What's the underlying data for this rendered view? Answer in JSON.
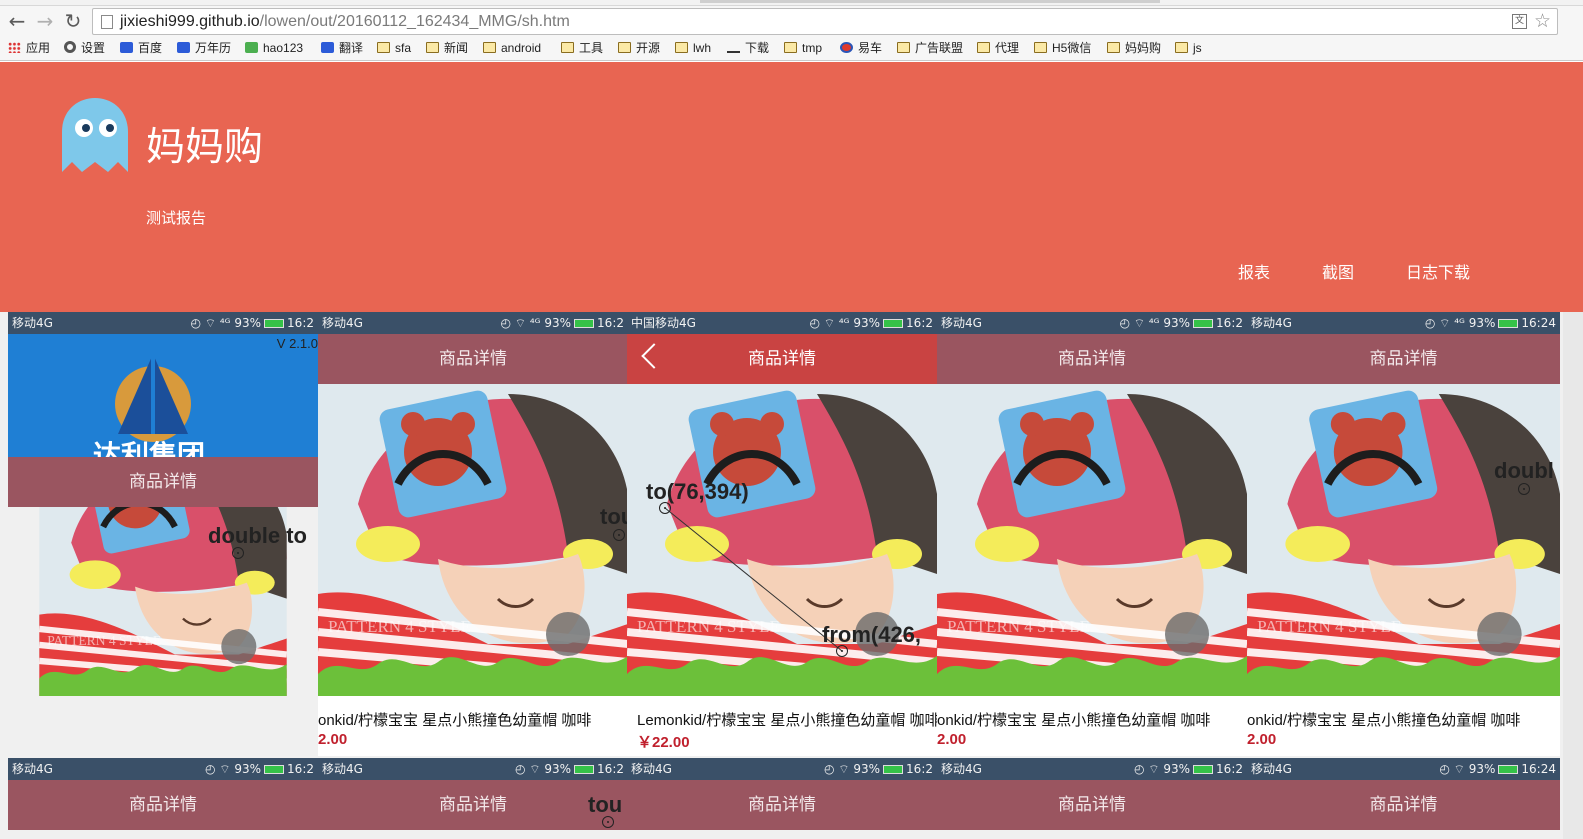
{
  "browser": {
    "back": "←",
    "forward": "→",
    "reload": "↻",
    "url_host": "jixieshi999.github.io",
    "url_path": "/lowen/out/20160112_162434_MMG/sh.htm",
    "translate_icon": "translate-icon",
    "star_icon": "☆"
  },
  "bookmarks": [
    {
      "label": "应用",
      "icon": "apps-grid-icon"
    },
    {
      "label": "设置",
      "icon": "gear-icon"
    },
    {
      "label": "百度",
      "icon": "baidu-paw-icon"
    },
    {
      "label": "万年历",
      "icon": "baidu-paw-icon"
    },
    {
      "label": "hao123",
      "icon": "hao123-icon"
    },
    {
      "label": "翻译",
      "icon": "translate-icon"
    },
    {
      "label": "sfa",
      "icon": "folder-icon"
    },
    {
      "label": "新闻",
      "icon": "folder-icon"
    },
    {
      "label": "android",
      "icon": "folder-icon"
    },
    {
      "label": "工具",
      "icon": "folder-icon"
    },
    {
      "label": "开源",
      "icon": "folder-icon"
    },
    {
      "label": "lwh",
      "icon": "folder-icon"
    },
    {
      "label": "下载",
      "icon": "download-icon"
    },
    {
      "label": "tmp",
      "icon": "folder-icon"
    },
    {
      "label": "易车",
      "icon": "yiche-icon"
    },
    {
      "label": "广告联盟",
      "icon": "folder-icon"
    },
    {
      "label": "代理",
      "icon": "folder-icon"
    },
    {
      "label": "H5微信",
      "icon": "folder-icon"
    },
    {
      "label": "妈妈购",
      "icon": "folder-icon"
    },
    {
      "label": "js",
      "icon": "folder-icon"
    }
  ],
  "header": {
    "brand": "妈妈购",
    "subtitle": "测试报告",
    "nav": [
      "报表",
      "截图",
      "日志下载"
    ],
    "logo_icon": "ghost-logo-icon",
    "background": "#e86552"
  },
  "gallery": {
    "status_left": [
      " 移动4G",
      "移动4G",
      "中国移动4G",
      "移动4G",
      "移动4G"
    ],
    "status_right": [
      {
        "signal": "⁴ᴳ",
        "battery": "93%",
        "time": "16:2"
      },
      {
        "signal": "⁴ᴳ",
        "battery": "93%",
        "time": "16:2"
      },
      {
        "signal": "⁴ᴳ",
        "battery": "93%",
        "time": "16:2"
      },
      {
        "signal": "⁴ᴳ",
        "battery": "93%",
        "time": "16:2"
      },
      {
        "signal": "⁴ᴳ",
        "battery": "93%",
        "time": "16:24"
      }
    ],
    "page_title": "商品详情",
    "version": "V 2.1.0",
    "splash_text": "达利集团",
    "product_name": "Lemonkid/柠檬宝宝 星点小熊撞色幼童帽 咖啡",
    "product_name_cut": "onkid/柠檬宝宝 星点小熊撞色幼童帽 咖啡",
    "product_price": "￥22.00",
    "product_price_cut": "2.00",
    "watermark": "PATTERN 4 STYLE",
    "actions": {
      "double_tap": "double to",
      "tap_cut": "tou",
      "to": "to(76,394)",
      "from": "from(426,",
      "double_cut": "doubl"
    }
  }
}
